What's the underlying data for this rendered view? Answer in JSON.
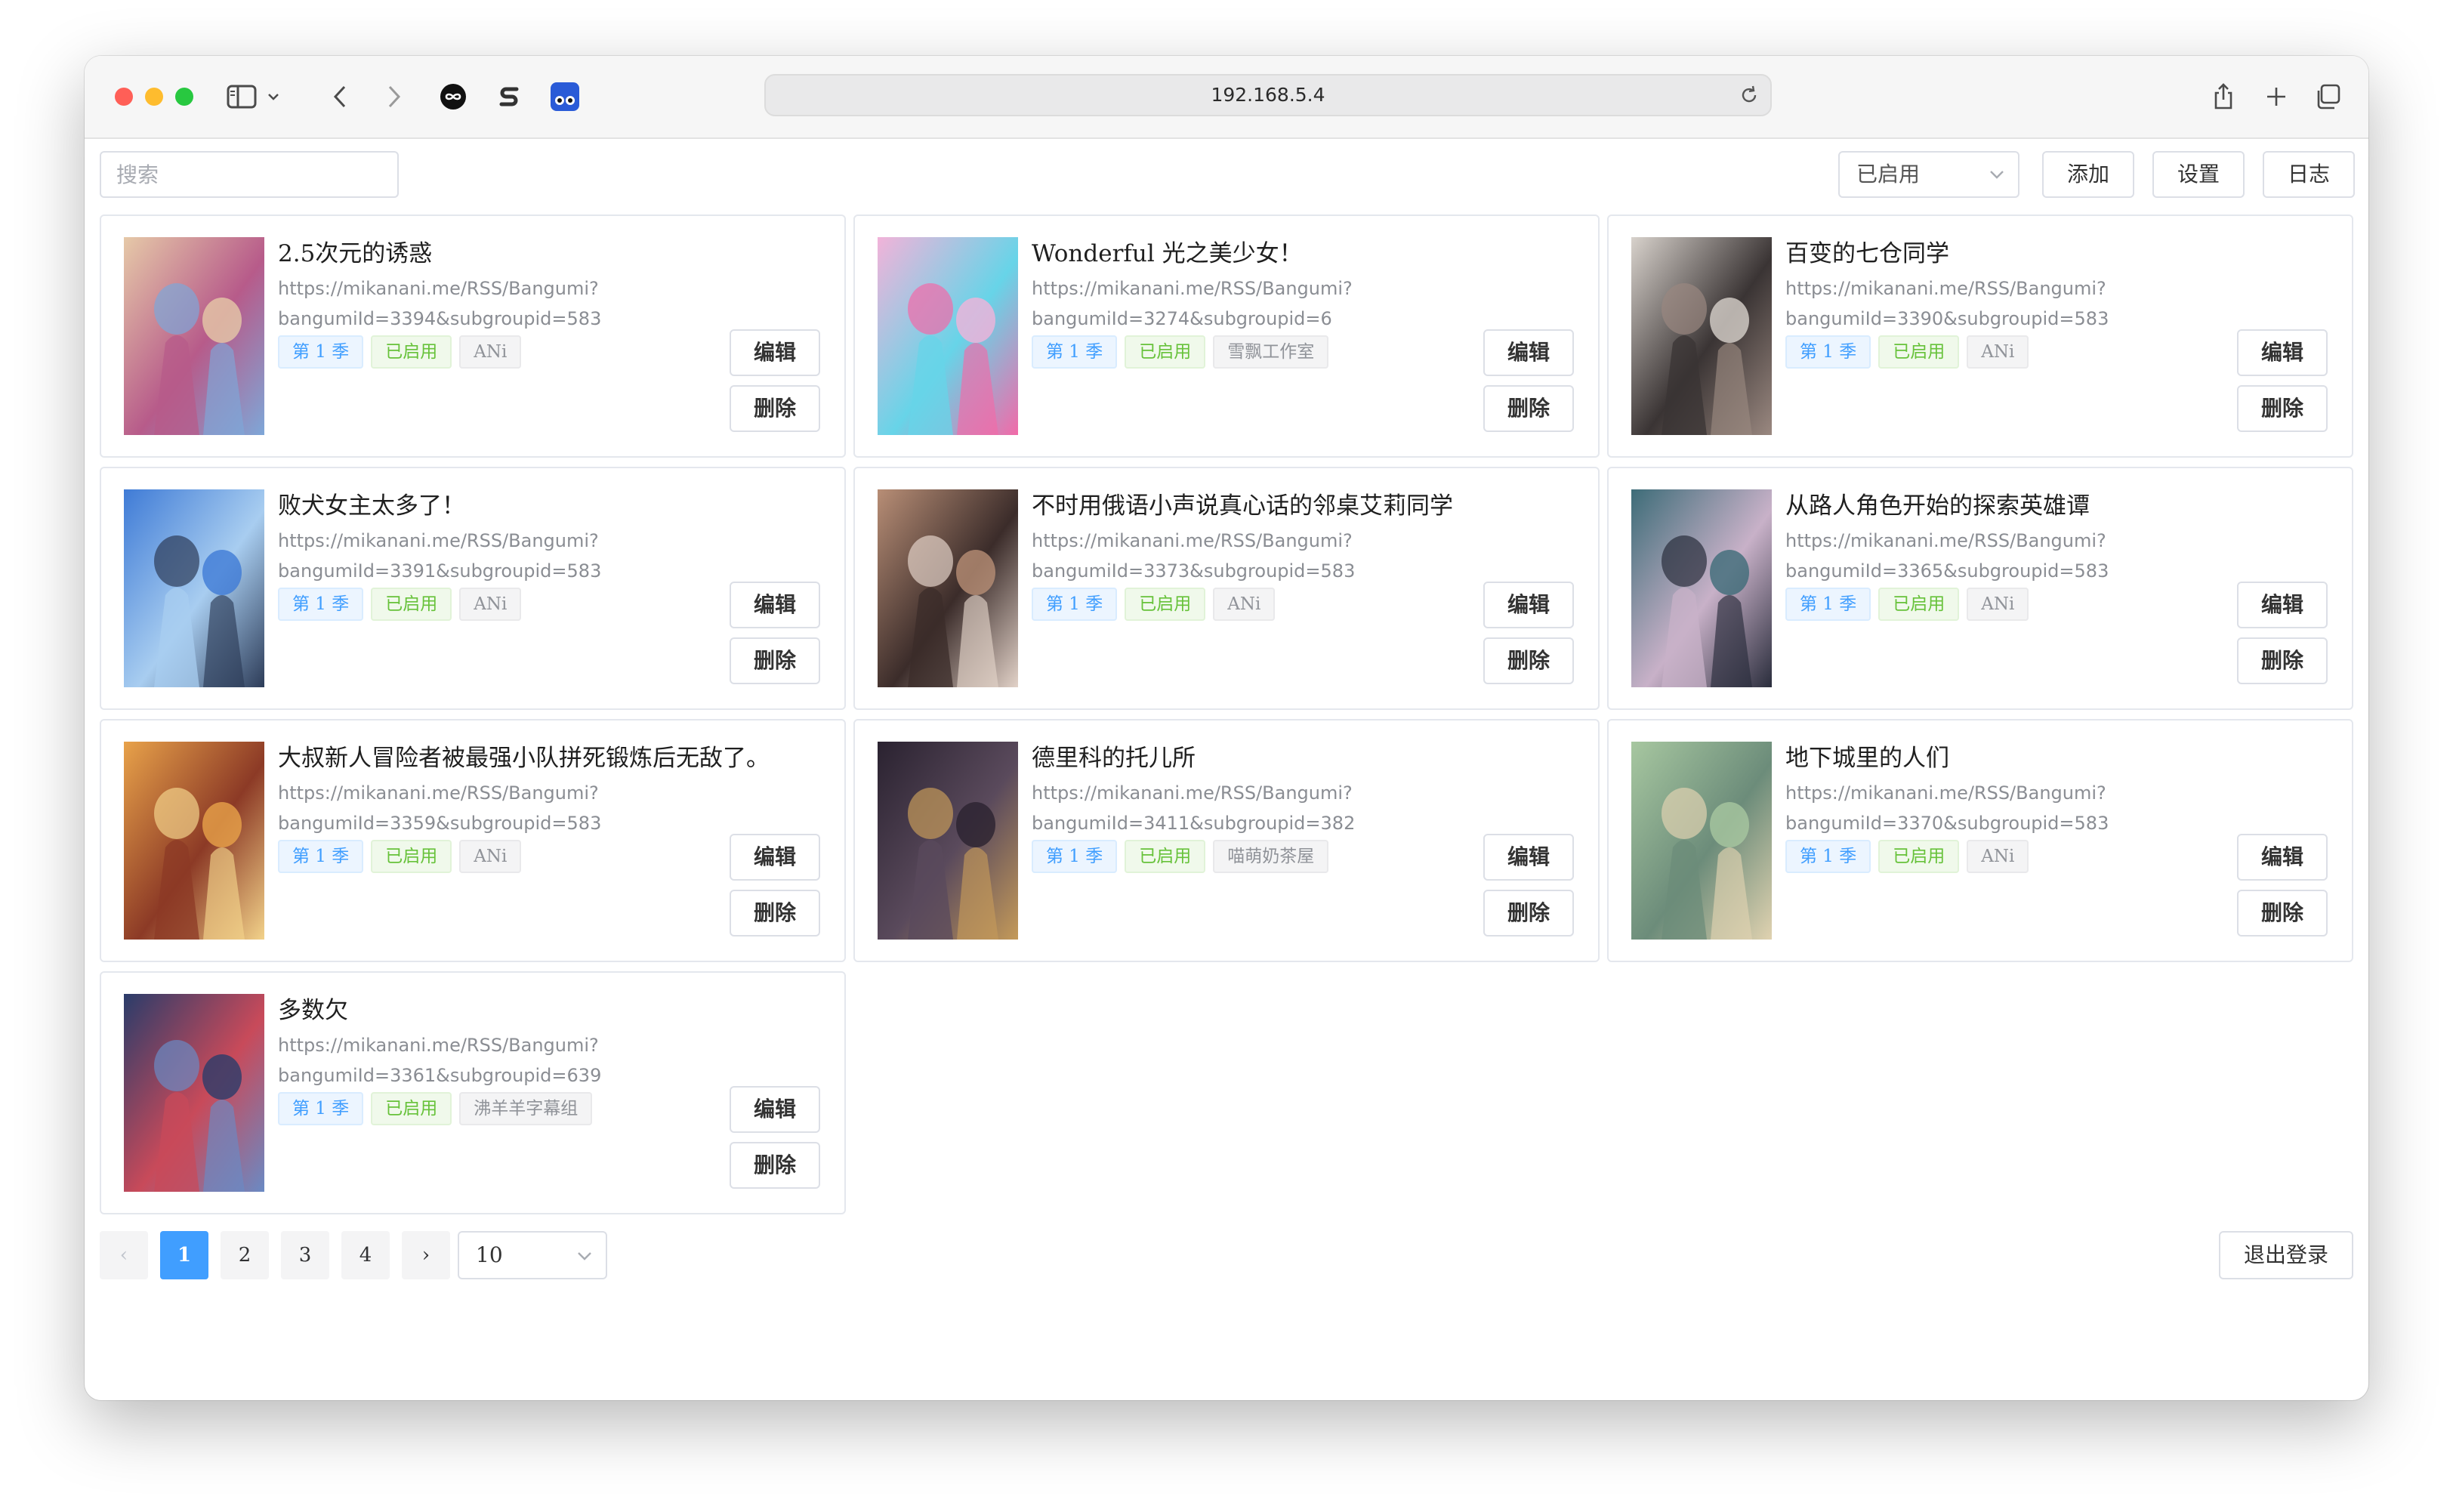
{
  "browser": {
    "url": "192.168.5.4",
    "toolbar_icons": [
      "sidebar-icon",
      "chevron-down-icon",
      "back-icon",
      "forward-icon",
      "infinity-extension-icon",
      "s-extension-icon",
      "blue-extension-icon",
      "share-icon",
      "new-tab-icon",
      "tabs-overview-icon"
    ]
  },
  "toolbar": {
    "search_placeholder": "搜索",
    "filter_value": "已启用",
    "add_label": "添加",
    "settings_label": "设置",
    "log_label": "日志"
  },
  "actions": {
    "edit_label": "编辑",
    "delete_label": "删除"
  },
  "items": [
    {
      "title": "2.5次元的诱惑",
      "url_line1": "https://mikanani.me/RSS/Bangumi?",
      "url_line2": "bangumiId=3394&subgroupid=583",
      "season": "第 1 季",
      "status": "已启用",
      "group": "ANi",
      "poster_colors": [
        "#e6c9a8",
        "#b75b8a",
        "#7ea7d8"
      ]
    },
    {
      "title": "Wonderful 光之美少女！",
      "url_line1": "https://mikanani.me/RSS/Bangumi?",
      "url_line2": "bangumiId=3274&subgroupid=6",
      "season": "第 1 季",
      "status": "已启用",
      "group": "雪飘工作室",
      "poster_colors": [
        "#f2b3d9",
        "#67d4e8",
        "#f26aa8"
      ]
    },
    {
      "title": "百变的七仓同学",
      "url_line1": "https://mikanani.me/RSS/Bangumi?",
      "url_line2": "bangumiId=3390&subgroupid=583",
      "season": "第 1 季",
      "status": "已启用",
      "group": "ANi",
      "poster_colors": [
        "#d8d2cc",
        "#3a3434",
        "#9a8880"
      ]
    },
    {
      "title": "败犬女主太多了！",
      "url_line1": "https://mikanani.me/RSS/Bangumi?",
      "url_line2": "bangumiId=3391&subgroupid=583",
      "season": "第 1 季",
      "status": "已启用",
      "group": "ANi",
      "poster_colors": [
        "#3f7bd6",
        "#a8cdf0",
        "#2d3c58"
      ]
    },
    {
      "title": "不时用俄语小声说真心话的邻桌艾莉同学",
      "url_line1": "https://mikanani.me/RSS/Bangumi?",
      "url_line2": "bangumiId=3373&subgroupid=583",
      "season": "第 1 季",
      "status": "已启用",
      "group": "ANi",
      "poster_colors": [
        "#b88e76",
        "#3b2c2a",
        "#e2d2c8"
      ]
    },
    {
      "title": "从路人角色开始的探索英雄谭",
      "url_line1": "https://mikanani.me/RSS/Bangumi?",
      "url_line2": "bangumiId=3365&subgroupid=583",
      "season": "第 1 季",
      "status": "已启用",
      "group": "ANi",
      "poster_colors": [
        "#3d6c78",
        "#c8b1c8",
        "#2a2d3c"
      ]
    },
    {
      "title": "大叔新人冒险者被最强小队拼死锻炼后无敌了。",
      "url_line1": "https://mikanani.me/RSS/Bangumi?",
      "url_line2": "bangumiId=3359&subgroupid=583",
      "season": "第 1 季",
      "status": "已启用",
      "group": "ANi",
      "poster_colors": [
        "#e8a24a",
        "#8c3a26",
        "#f2d28a"
      ]
    },
    {
      "title": "德里科的托儿所",
      "url_line1": "https://mikanani.me/RSS/Bangumi?",
      "url_line2": "bangumiId=3411&subgroupid=382",
      "season": "第 1 季",
      "status": "已启用",
      "group": "喵萌奶茶屋",
      "poster_colors": [
        "#2a2230",
        "#5a4a5c",
        "#c49a5a"
      ]
    },
    {
      "title": "地下城里的人们",
      "url_line1": "https://mikanani.me/RSS/Bangumi?",
      "url_line2": "bangumiId=3370&subgroupid=583",
      "season": "第 1 季",
      "status": "已启用",
      "group": "ANi",
      "poster_colors": [
        "#a7c7a0",
        "#6c8c7a",
        "#e0d2b0"
      ]
    },
    {
      "title": "多数欠",
      "url_line1": "https://mikanani.me/RSS/Bangumi?",
      "url_line2": "bangumiId=3361&subgroupid=639",
      "season": "第 1 季",
      "status": "已启用",
      "group": "沸羊羊字幕组",
      "poster_colors": [
        "#2a3c6a",
        "#c84a5a",
        "#6a8ac4"
      ]
    }
  ],
  "pagination": {
    "prev_label": "‹",
    "next_label": "›",
    "pages": [
      "1",
      "2",
      "3",
      "4"
    ],
    "active_page": "1",
    "page_size": "10"
  },
  "logout_label": "退出登录",
  "accent_color": "#409eff"
}
